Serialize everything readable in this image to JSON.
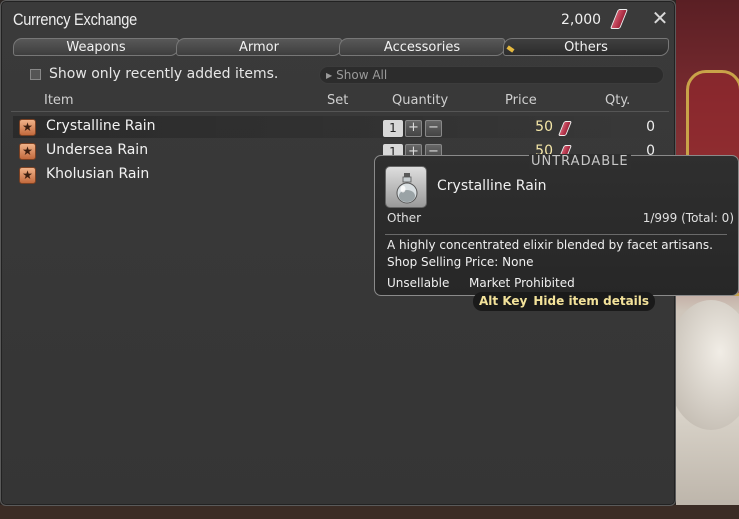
{
  "window": {
    "title": "Currency Exchange",
    "balance": "2,000"
  },
  "tabs": [
    {
      "label": "Weapons",
      "active": false
    },
    {
      "label": "Armor",
      "active": false
    },
    {
      "label": "Accessories",
      "active": false
    },
    {
      "label": "Others",
      "active": true
    }
  ],
  "filter": {
    "checkbox_label": "Show only recently added items.",
    "dropdown_value": "Show All"
  },
  "columns": {
    "item": "Item",
    "set": "Set",
    "quantity": "Quantity",
    "price": "Price",
    "qty": "Qty."
  },
  "rows": [
    {
      "name": "Crystalline Rain",
      "quantity": "1",
      "price": "50",
      "qty": "0",
      "icon": "star-icon"
    },
    {
      "name": "Undersea Rain",
      "quantity": "1",
      "price": "50",
      "qty": "0",
      "icon": "star-icon"
    },
    {
      "name": "Kholusian Rain",
      "icon": "star-icon"
    }
  ],
  "tooltip": {
    "tag": "UNTRADABLE",
    "name": "Crystalline Rain",
    "category": "Other",
    "stack": "1/999 (Total: 0)",
    "description": "A highly concentrated elixir blended by facet artisans.",
    "sell_price": "Shop Selling Price: None",
    "unsellable": "Unsellable",
    "market": "Market Prohibited",
    "icon": "potion-bottle-icon"
  },
  "hint": {
    "key": "Alt Key",
    "action": "Hide item details"
  },
  "colors": {
    "currency_gem": "#b52a40",
    "price_text": "#f5e7a8",
    "hint_text": "#f3e29a",
    "tab_active_accent": "#e5b93f"
  }
}
